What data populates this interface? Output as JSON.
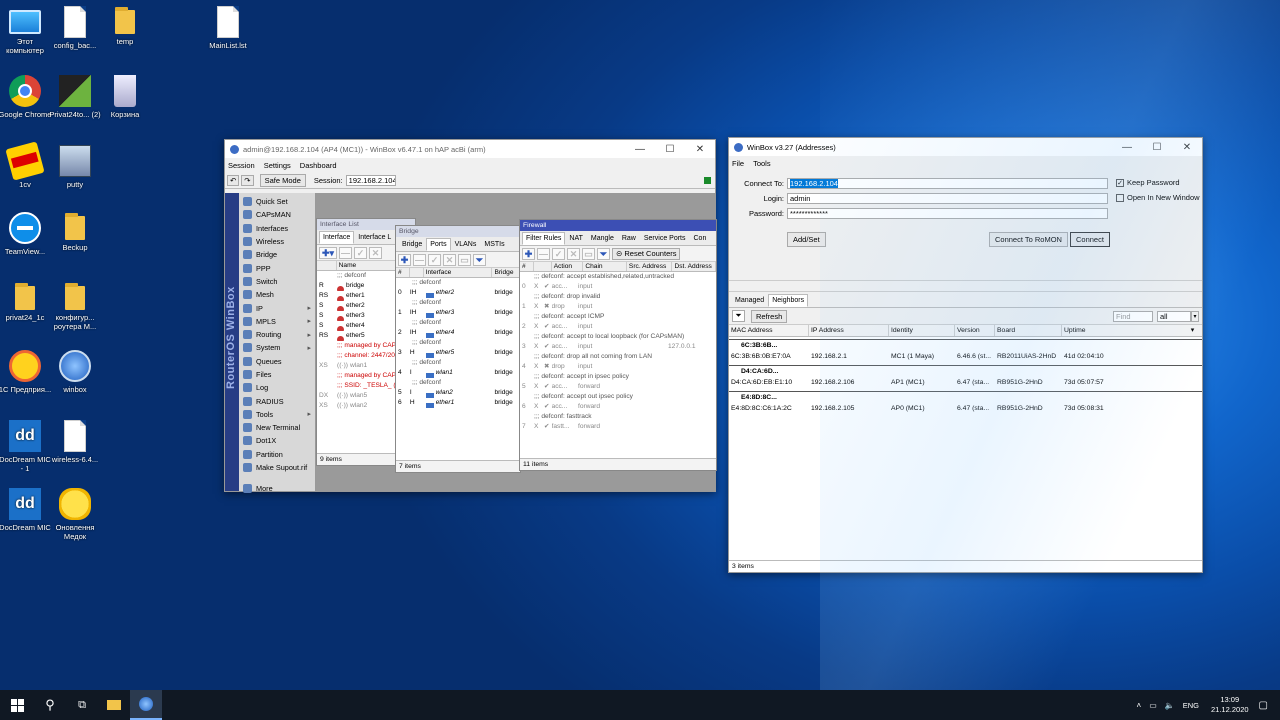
{
  "desktop": {
    "icons": [
      {
        "label": "Этот компьютер",
        "kind": "pc"
      },
      {
        "label": "config_bac...",
        "kind": "file"
      },
      {
        "label": "temp",
        "kind": "folder"
      },
      {
        "label": "MainList.lst",
        "kind": "file"
      },
      {
        "label": "Google Chrome",
        "kind": "chrome"
      },
      {
        "label": "Privat24to... (2)",
        "kind": "app"
      },
      {
        "label": "Корзина",
        "kind": "bin"
      },
      {
        "label": "1cv",
        "kind": "app"
      },
      {
        "label": "putty",
        "kind": "app"
      },
      {
        "label": "TeamView...",
        "kind": "app"
      },
      {
        "label": "Beckup",
        "kind": "folder"
      },
      {
        "label": "privat24_1c",
        "kind": "folder"
      },
      {
        "label": "конфигур... роутера M...",
        "kind": "folder"
      },
      {
        "label": "1С Предприя...",
        "kind": "app"
      },
      {
        "label": "winbox",
        "kind": "app"
      },
      {
        "label": "DocDream MIC - 1",
        "kind": "app"
      },
      {
        "label": "wireless-6.4...",
        "kind": "file"
      },
      {
        "label": "DocDream MIC",
        "kind": "app"
      },
      {
        "label": "Оновлення Медок",
        "kind": "app"
      }
    ]
  },
  "winbox1": {
    "title": "admin@192.168.2.104 (AP4 (MC1)) - WinBox v6.47.1 on hAP acBi (arm)",
    "menu": [
      "Session",
      "Settings",
      "Dashboard"
    ],
    "safe_mode": "Safe Mode",
    "session_label": "Session:",
    "session_value": "192.168.2.104",
    "brand": "RouterOS WinBox",
    "sidebar": [
      "Quick Set",
      "CAPsMAN",
      "Interfaces",
      "Wireless",
      "Bridge",
      "PPP",
      "Switch",
      "Mesh",
      "IP",
      "MPLS",
      "Routing",
      "System",
      "Queues",
      "Files",
      "Log",
      "RADIUS",
      "Tools",
      "New Terminal",
      "Dot1X",
      "Partition",
      "Make Supout.rif",
      "More"
    ],
    "iface": {
      "title": "Interface List",
      "tabs": [
        "Interface",
        "Interface L"
      ],
      "col_name": "Name",
      "rows": [
        {
          "flag": "",
          "name": ";;; defconf",
          "type": "cmt"
        },
        {
          "flag": "R",
          "name": "bridge",
          "type": "if"
        },
        {
          "flag": "RS",
          "name": "ether1",
          "type": "if"
        },
        {
          "flag": "S",
          "name": "ether2",
          "type": "if"
        },
        {
          "flag": "S",
          "name": "ether3",
          "type": "if"
        },
        {
          "flag": "S",
          "name": "ether4",
          "type": "if"
        },
        {
          "flag": "RS",
          "name": "ether5",
          "type": "if"
        },
        {
          "flag": "",
          "name": ";;; managed by CAPs",
          "type": "red"
        },
        {
          "flag": "",
          "name": ";;; channel: 2447/20",
          "type": "red"
        },
        {
          "flag": "XS",
          "name": "wlan1",
          "type": "gray"
        },
        {
          "flag": "",
          "name": ";;; managed by CAPs",
          "type": "red"
        },
        {
          "flag": "",
          "name": ";;; SSID: _TESLA_ (",
          "type": "red"
        },
        {
          "flag": "DX",
          "name": "wlan5",
          "type": "gray"
        },
        {
          "flag": "XS",
          "name": "wlan2",
          "type": "gray"
        }
      ],
      "status": "9 items"
    },
    "bridge": {
      "title": "Bridge",
      "tabs": [
        "Bridge",
        "Ports",
        "VLANs",
        "MSTIs"
      ],
      "cols": [
        "#",
        "Interface",
        "Bridge"
      ],
      "rows": [
        {
          "n": "",
          "f": "",
          "i": ";;; defconf",
          "b": "",
          "type": "cmt"
        },
        {
          "n": "0",
          "f": "IH",
          "i": "ether2",
          "b": "bridge",
          "type": "r"
        },
        {
          "n": "",
          "f": "",
          "i": ";;; defconf",
          "b": "",
          "type": "cmt"
        },
        {
          "n": "1",
          "f": "IH",
          "i": "ether3",
          "b": "bridge",
          "type": "r"
        },
        {
          "n": "",
          "f": "",
          "i": ";;; defconf",
          "b": "",
          "type": "cmt"
        },
        {
          "n": "2",
          "f": "IH",
          "i": "ether4",
          "b": "bridge",
          "type": "r"
        },
        {
          "n": "",
          "f": "",
          "i": ";;; defconf",
          "b": "",
          "type": "cmt"
        },
        {
          "n": "3",
          "f": "H",
          "i": "ether5",
          "b": "bridge",
          "type": "r"
        },
        {
          "n": "",
          "f": "",
          "i": ";;; defconf",
          "b": "",
          "type": "cmt"
        },
        {
          "n": "4",
          "f": "I",
          "i": "wlan1",
          "b": "bridge",
          "type": "r"
        },
        {
          "n": "",
          "f": "",
          "i": ";;; defconf",
          "b": "",
          "type": "cmt"
        },
        {
          "n": "5",
          "f": "I",
          "i": "wlan2",
          "b": "bridge",
          "type": "r"
        },
        {
          "n": "6",
          "f": "H",
          "i": "ether1",
          "b": "bridge",
          "type": "r"
        }
      ],
      "status": "7 items"
    },
    "firewall": {
      "title": "Firewall",
      "tabs": [
        "Filter Rules",
        "NAT",
        "Mangle",
        "Raw",
        "Service Ports",
        "Con"
      ],
      "reset": "Reset Counters",
      "cols": [
        "#",
        "Action",
        "Chain",
        "Src. Address",
        "Dst. Address"
      ],
      "rows": [
        {
          "n": "",
          "a": ";;; defconf: accept established,related,untracked",
          "c": "",
          "s": "",
          "d": "",
          "type": "cmt"
        },
        {
          "n": "0",
          "x": "X",
          "a": "acc...",
          "c": "input",
          "s": "",
          "d": "",
          "type": "r"
        },
        {
          "n": "",
          "a": ";;; defconf: drop invalid",
          "c": "",
          "s": "",
          "d": "",
          "type": "cmt"
        },
        {
          "n": "1",
          "x": "X",
          "a": "drop",
          "c": "input",
          "s": "",
          "d": "",
          "type": "r"
        },
        {
          "n": "",
          "a": ";;; defconf: accept ICMP",
          "c": "",
          "s": "",
          "d": "",
          "type": "cmt"
        },
        {
          "n": "2",
          "x": "X",
          "a": "acc...",
          "c": "input",
          "s": "",
          "d": "",
          "type": "r"
        },
        {
          "n": "",
          "a": ";;; defconf: accept to local loopback (for CAPsMAN)",
          "c": "",
          "s": "",
          "d": "",
          "type": "cmt"
        },
        {
          "n": "3",
          "x": "X",
          "a": "acc...",
          "c": "input",
          "s": "",
          "d": "127.0.0.1",
          "type": "r"
        },
        {
          "n": "",
          "a": ";;; defconf: drop all not coming from LAN",
          "c": "",
          "s": "",
          "d": "",
          "type": "cmt"
        },
        {
          "n": "4",
          "x": "X",
          "a": "drop",
          "c": "input",
          "s": "",
          "d": "",
          "type": "r"
        },
        {
          "n": "",
          "a": ";;; defconf: accept in ipsec policy",
          "c": "",
          "s": "",
          "d": "",
          "type": "cmt"
        },
        {
          "n": "5",
          "x": "X",
          "a": "acc...",
          "c": "forward",
          "s": "",
          "d": "",
          "type": "r"
        },
        {
          "n": "",
          "a": ";;; defconf: accept out ipsec policy",
          "c": "",
          "s": "",
          "d": "",
          "type": "cmt"
        },
        {
          "n": "6",
          "x": "X",
          "a": "acc...",
          "c": "forward",
          "s": "",
          "d": "",
          "type": "r"
        },
        {
          "n": "",
          "a": ";;; defconf: fasttrack",
          "c": "",
          "s": "",
          "d": "",
          "type": "cmt"
        },
        {
          "n": "7",
          "x": "X",
          "a": "fastt...",
          "c": "forward",
          "s": "",
          "d": "",
          "type": "r"
        }
      ],
      "status": "11 items"
    }
  },
  "winbox2": {
    "title": "WinBox v3.27 (Addresses)",
    "menu": [
      "File",
      "Tools"
    ],
    "connect_to_label": "Connect To:",
    "connect_to_value": "192.168.2.104",
    "login_label": "Login:",
    "login_value": "admin",
    "password_label": "Password:",
    "password_value": "*************",
    "keep_password": "Keep Password",
    "open_new_window": "Open In New Window",
    "add_set": "Add/Set",
    "connect_romon": "Connect To RoMON",
    "connect": "Connect",
    "tabs": [
      "Managed",
      "Neighbors"
    ],
    "refresh": "Refresh",
    "find_placeholder": "Find",
    "filter_value": "all",
    "cols": [
      "MAC Address",
      "IP Address",
      "Identity",
      "Version",
      "Board",
      "Uptime"
    ],
    "groups": [
      {
        "header": "6C:3B:6B...",
        "mac": "6C:3B:6B:0B:E7:0A",
        "ip": "192.168.2.1",
        "identity": "MC1 (1 Maya)",
        "version": "6.46.6 (st...",
        "board": "RB2011UiAS-2HnD",
        "uptime": "41d 02:04:10"
      },
      {
        "header": "D4:CA:6D...",
        "mac": "D4:CA:6D:EB:E1:10",
        "ip": "192.168.2.106",
        "identity": "AP1 (MC1)",
        "version": "6.47 (sta...",
        "board": "RB951G-2HnD",
        "uptime": "73d 05:07:57"
      },
      {
        "header": "E4:8D:8C...",
        "mac": "E4:8D:8C:C6:1A:2C",
        "ip": "192.168.2.105",
        "identity": "AP0 (MC1)",
        "version": "6.47 (sta...",
        "board": "RB951G-2HnD",
        "uptime": "73d 05:08:31"
      }
    ],
    "status": "3 items"
  },
  "taskbar": {
    "lang": "ENG",
    "time": "13:09",
    "date": "21.12.2020"
  }
}
